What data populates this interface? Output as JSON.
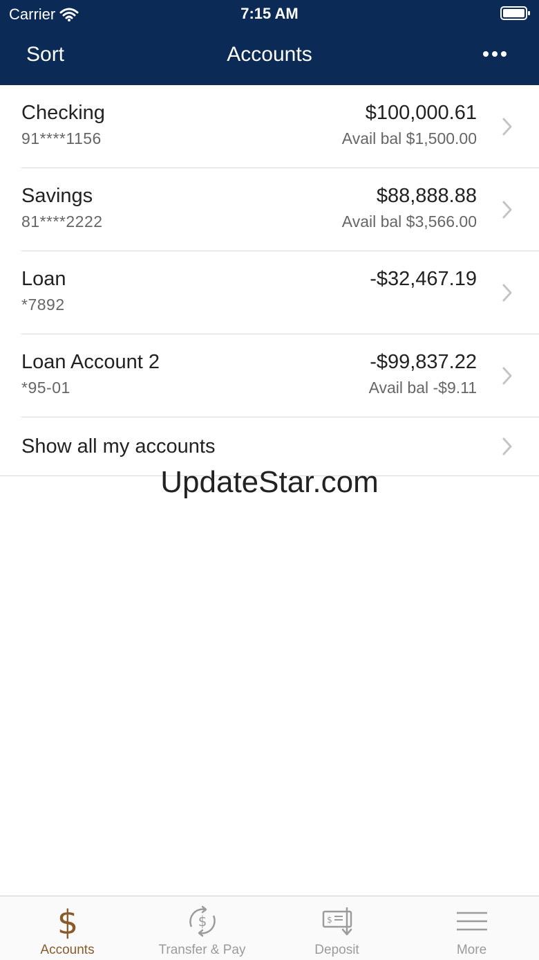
{
  "status_bar": {
    "carrier": "Carrier",
    "time": "7:15 AM"
  },
  "nav": {
    "sort_label": "Sort",
    "title": "Accounts"
  },
  "accounts": [
    {
      "name": "Checking",
      "number": "91****1156",
      "balance": "$100,000.61",
      "avail": "Avail bal $1,500.00"
    },
    {
      "name": "Savings",
      "number": "81****2222",
      "balance": "$88,888.88",
      "avail": "Avail bal $3,566.00"
    },
    {
      "name": "Loan",
      "number": "*7892",
      "balance": "-$32,467.19",
      "avail": ""
    },
    {
      "name": "Loan Account 2",
      "number": "*95-01",
      "balance": "-$99,837.22",
      "avail": "Avail bal -$9.11"
    }
  ],
  "show_all_label": "Show all my accounts",
  "watermark": "UpdateStar.com",
  "tabs": [
    {
      "label": "Accounts",
      "icon": "dollar-icon",
      "active": true
    },
    {
      "label": "Transfer & Pay",
      "icon": "transfer-dollar-icon",
      "active": false
    },
    {
      "label": "Deposit",
      "icon": "check-deposit-icon",
      "active": false
    },
    {
      "label": "More",
      "icon": "hamburger-menu-icon",
      "active": false
    }
  ],
  "colors": {
    "header_bg": "#0b2a55",
    "active_tab": "#8a5a2b",
    "inactive_tab": "#9b9b9b",
    "divider": "#d9d9d9"
  }
}
